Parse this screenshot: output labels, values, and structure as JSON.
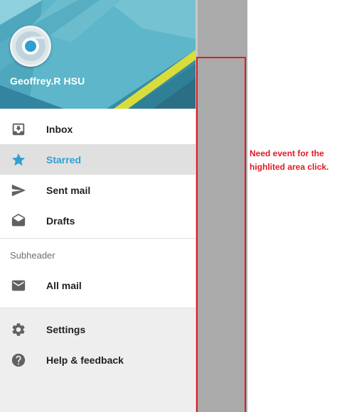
{
  "user": {
    "name": "Geoffrey.R HSU"
  },
  "menu": {
    "primary": [
      {
        "label": "Inbox",
        "icon": "inbox-icon"
      },
      {
        "label": "Starred",
        "icon": "star-icon",
        "active": true
      },
      {
        "label": "Sent mail",
        "icon": "send-icon"
      },
      {
        "label": "Drafts",
        "icon": "drafts-icon"
      }
    ],
    "subheader": "Subheader",
    "secondary": [
      {
        "label": "All mail",
        "icon": "mail-icon"
      }
    ],
    "footer": [
      {
        "label": "Settings",
        "icon": "gear-icon"
      },
      {
        "label": "Help & feedback",
        "icon": "help-icon"
      }
    ]
  },
  "annotation": {
    "text": "Need event for the highlited area click."
  },
  "colors": {
    "accent": "#2fa0d6",
    "highlight": "#e01b24",
    "scrim": "#aaaaaa"
  }
}
